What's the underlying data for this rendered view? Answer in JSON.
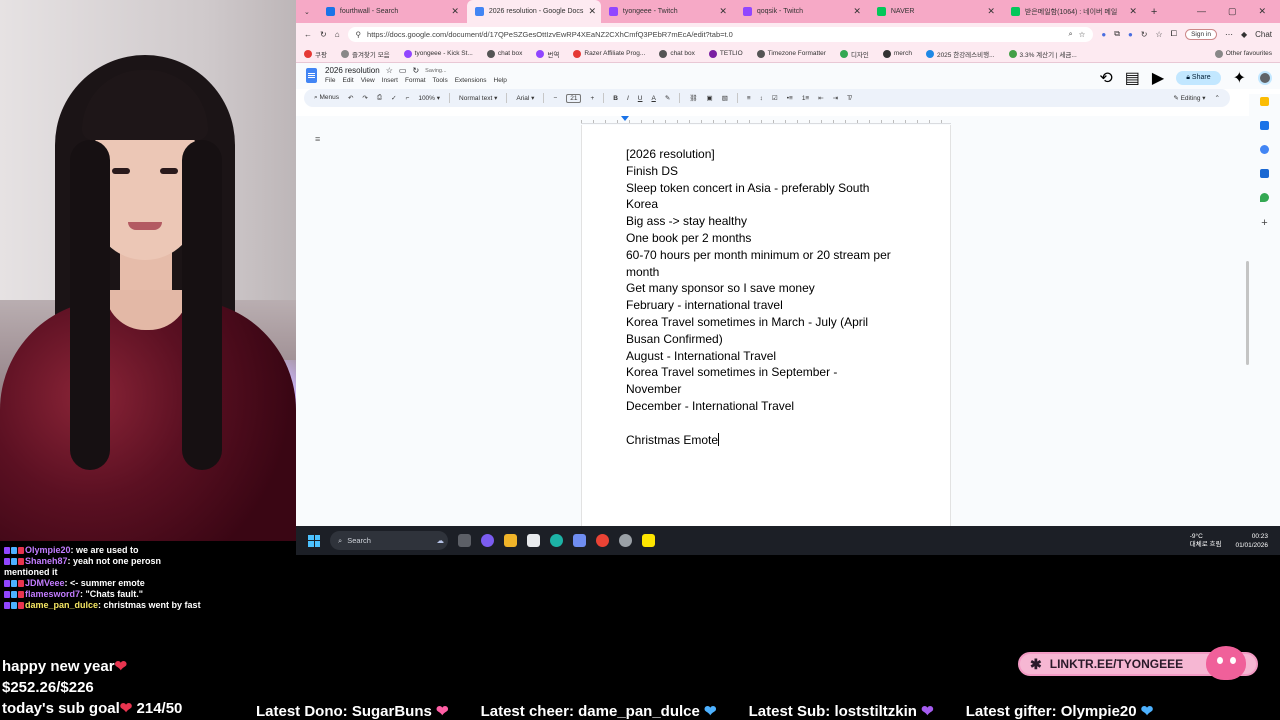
{
  "browser": {
    "tabs": [
      {
        "title": "fourthwall - Search",
        "color": "#1a73e8",
        "active": false
      },
      {
        "title": "2026 resolution - Google Docs",
        "color": "#4285f4",
        "active": true
      },
      {
        "title": "tyongeee - Twitch",
        "color": "#9146ff",
        "active": false
      },
      {
        "title": "qoqsik - Twitch",
        "color": "#9146ff",
        "active": false
      },
      {
        "title": "NAVER",
        "color": "#03c75a",
        "active": false
      },
      {
        "title": "받은메일함(1064) : 네이버 메일",
        "color": "#03c75a",
        "active": false
      }
    ],
    "url": "https://docs.google.com/document/d/17QPeSZGesOttIzvEwRP4XEaNZ2CXhCmfQ3PEbR7mEcA/edit?tab=t.0",
    "sign_in": "Sign in",
    "chat": "Chat",
    "bookmarks": [
      {
        "label": "쿠팡",
        "color": "#e53935"
      },
      {
        "label": "즐겨찾기 모음",
        "color": "#888888"
      },
      {
        "label": "tyongeee - Kick St...",
        "color": "#9146ff"
      },
      {
        "label": "chat box",
        "color": "#555555"
      },
      {
        "label": "번역",
        "color": "#9146ff"
      },
      {
        "label": "Razer Affiliate Prog...",
        "color": "#e53935"
      },
      {
        "label": "chat box",
        "color": "#555555"
      },
      {
        "label": "TETLIO",
        "color": "#7b1fa2"
      },
      {
        "label": "Timezone Formatter",
        "color": "#555555"
      },
      {
        "label": "디자인",
        "color": "#34a853"
      },
      {
        "label": "merch",
        "color": "#333333"
      },
      {
        "label": "2025 한강레스비행...",
        "color": "#1e88e5"
      },
      {
        "label": "3.3% 계산기 | 세금...",
        "color": "#43a047"
      },
      {
        "label": "Other favourites",
        "color": "#888888"
      }
    ]
  },
  "docs": {
    "title": "2026 resolution",
    "saving": "Saving...",
    "menu": [
      "File",
      "Edit",
      "View",
      "Insert",
      "Format",
      "Tools",
      "Extensions",
      "Help"
    ],
    "share": "Share",
    "toolbar": {
      "menus": "Menus",
      "zoom": "100%",
      "style": "Normal text",
      "font": "Arial",
      "font_size": "21",
      "mode": "Editing"
    },
    "lines": [
      "[2026 resolution]",
      "Finish DS",
      "Sleep token concert in Asia - preferably South",
      "Korea",
      "Big ass -> stay healthy",
      "One book per 2 months",
      "60-70 hours per month minimum or 20 stream per",
      "month",
      "Get many sponsor so I save money",
      "February - international travel",
      "Korea Travel sometimes in March - July (April",
      "Busan Confirmed)",
      "August - International Travel",
      "Korea Travel sometimes in September -",
      "November",
      "December - International Travel",
      "",
      "Christmas Emote"
    ]
  },
  "taskbar": {
    "search": "Search",
    "weather_temp": "-9°C",
    "weather_desc": "대체로 흐림",
    "time": "00:23",
    "date": "01/01/2026"
  },
  "chat": [
    {
      "user": "Olympie20",
      "user_color": "#c27cff",
      "text": ": we are used to"
    },
    {
      "user": "Shaneh87",
      "user_color": "#c27cff",
      "text": ": yeah not one perosn mentioned it"
    },
    {
      "user": "JDMVeee",
      "user_color": "#c27cff",
      "text": ": <- summer emote"
    },
    {
      "user": "flamesword7",
      "user_color": "#c27cff",
      "text": ": \"Chats fault.\""
    },
    {
      "user": "dame_pan_dulce",
      "user_color": "#f5e663",
      "text": ": christmas went by fast"
    }
  ],
  "overlay": {
    "greeting": "happy new year",
    "goal_amount": "$252.26/$226",
    "sub_goal_label": "today's sub goal",
    "sub_goal_value": "214/50",
    "latest_dono": "Latest Dono: SugarBuns",
    "latest_cheer": "Latest cheer: dame_pan_dulce",
    "latest_sub": "Latest Sub: loststiltzkin",
    "latest_gifter": "Latest gifter: Olympie20",
    "linktree": "LINKTR.EE/TYONGEEE"
  }
}
